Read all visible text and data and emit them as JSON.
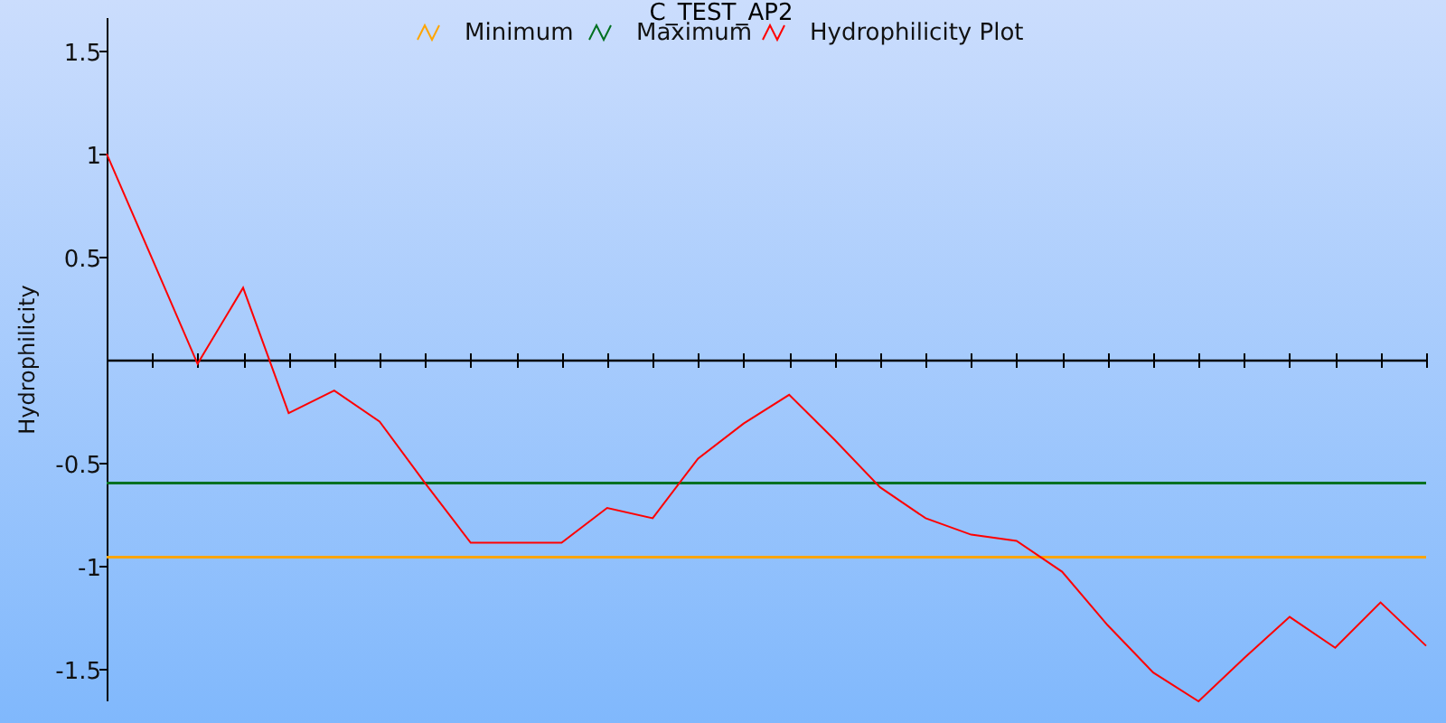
{
  "chart": {
    "chart_data": {
      "type": "line",
      "title": "C_TEST_AP2",
      "ylabel": "Hydrophilicity",
      "legend": true,
      "ylim": [
        -1.66,
        1.66
      ],
      "yticks": [
        1.5,
        1,
        0.5,
        -0.5,
        -1,
        -1.5
      ],
      "series": [
        {
          "name": "Minimum",
          "color": "#ffa500",
          "values": [
            -0.96,
            -0.96,
            -0.96,
            -0.96,
            -0.96,
            -0.96,
            -0.96,
            -0.96,
            -0.96,
            -0.96,
            -0.96,
            -0.96,
            -0.96,
            -0.96,
            -0.96,
            -0.96,
            -0.96,
            -0.96,
            -0.96,
            -0.96,
            -0.96,
            -0.96,
            -0.96,
            -0.96,
            -0.96,
            -0.96,
            -0.96,
            -0.96,
            -0.96,
            -0.96
          ]
        },
        {
          "name": "Maximum",
          "color": "#007020",
          "values": [
            -0.6,
            -0.6,
            -0.6,
            -0.6,
            -0.6,
            -0.6,
            -0.6,
            -0.6,
            -0.6,
            -0.6,
            -0.6,
            -0.6,
            -0.6,
            -0.6,
            -0.6,
            -0.6,
            -0.6,
            -0.6,
            -0.6,
            -0.6,
            -0.6,
            -0.6,
            -0.6,
            -0.6,
            -0.6,
            -0.6,
            -0.6,
            -0.6,
            -0.6,
            -0.6
          ]
        },
        {
          "name": "Hydrophilicity Plot",
          "color": "#ff0000",
          "values": [
            1.0,
            0.49,
            -0.02,
            0.35,
            -0.26,
            -0.15,
            -0.3,
            -0.6,
            -0.89,
            -0.89,
            -0.89,
            -0.72,
            -0.77,
            -0.48,
            -0.31,
            -0.17,
            -0.39,
            -0.62,
            -0.77,
            -0.85,
            -0.88,
            -1.03,
            -1.29,
            -1.52,
            -1.66,
            -1.45,
            -1.25,
            -1.4,
            -1.18,
            -1.39
          ]
        }
      ]
    }
  }
}
